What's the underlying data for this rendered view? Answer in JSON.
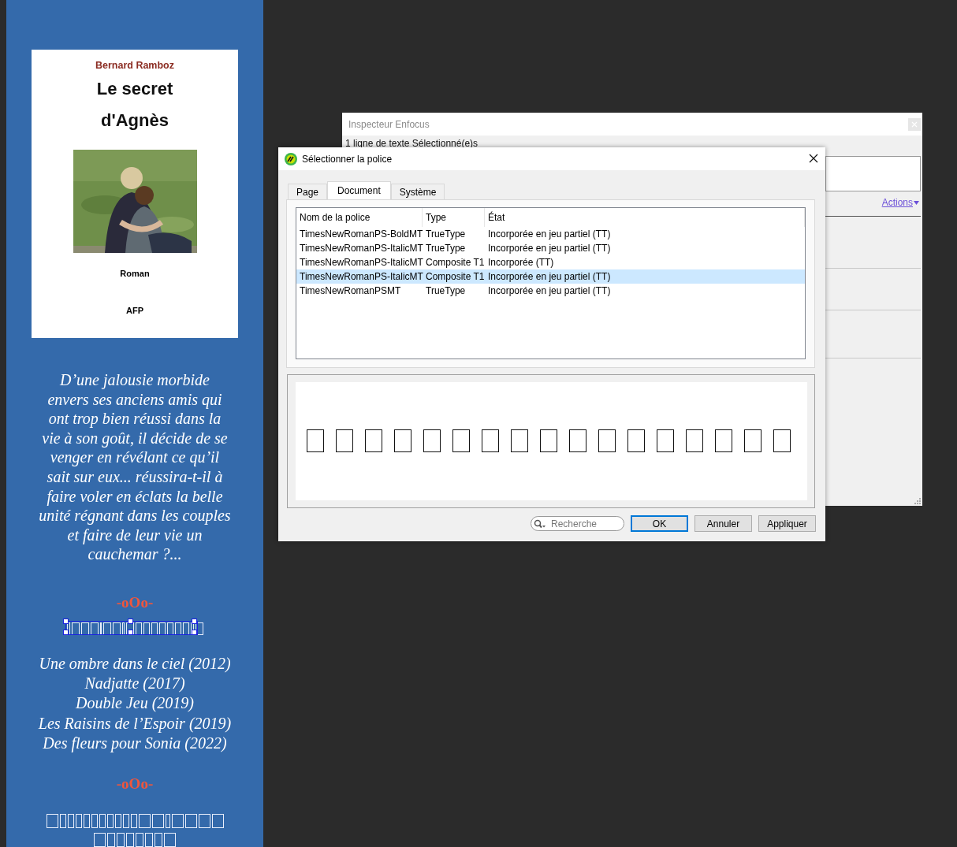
{
  "cover": {
    "author": "Bernard Ramboz",
    "title_lines": [
      "Le secret",
      "d'Agnès"
    ],
    "photo": {
      "kind": "picture"
    },
    "genre": "Roman",
    "publisher": "AFP"
  },
  "blurb": "D’une jalousie morbide envers ses anciens amis qui ont trop bien réussi dans la vie à son goût, il décide de se venger en révélant ce qu’il sait sur eux... réussira-t-il à faire voler en éclats la belle unité régnant dans les couples et faire de leur vie un cauchemar ?...",
  "ornaments": [
    "-oOo-",
    "-oOo-"
  ],
  "books": [
    "Une ombre dans le ciel (2012)",
    "Nadjatte (2017)",
    "Double Jeu (2019)",
    "Les Raisins de l’Espoir (2019)",
    "Des fleurs pour Sonia (2022)"
  ],
  "inspector": {
    "title": "Inspecteur Enfocus",
    "selection": "1 ligne de texte Sélectionné(e)s",
    "actions_link": "Actions"
  },
  "dialog": {
    "title": "Sélectionner la police",
    "tabs": [
      {
        "label": "Page",
        "selected": false
      },
      {
        "label": "Document",
        "selected": true
      },
      {
        "label": "Système",
        "selected": false
      }
    ],
    "columns": [
      "Nom de la police",
      "Type",
      "État"
    ],
    "rows": [
      {
        "name": "TimesNewRomanPS-BoldMT",
        "type": "TrueType",
        "state": "Incorporée en jeu partiel (TT)",
        "selected": false
      },
      {
        "name": "TimesNewRomanPS-ItalicMT",
        "type": "TrueType",
        "state": "Incorporée en jeu partiel (TT)",
        "selected": false
      },
      {
        "name": "TimesNewRomanPS-ItalicMT",
        "type": "Composite T1",
        "state": "Incorporée (TT)",
        "selected": false
      },
      {
        "name": "TimesNewRomanPS-ItalicMT",
        "type": "Composite T1",
        "state": "Incorporée en jeu partiel (TT)",
        "selected": true
      },
      {
        "name": "TimesNewRomanPSMT",
        "type": "TrueType",
        "state": "Incorporée en jeu partiel (TT)",
        "selected": false
      }
    ],
    "search": {
      "placeholder": "Recherche"
    },
    "buttons": [
      {
        "label": "OK",
        "default": true
      },
      {
        "label": "Annuler",
        "default": false
      },
      {
        "label": "Appliquer",
        "default": false
      }
    ]
  }
}
